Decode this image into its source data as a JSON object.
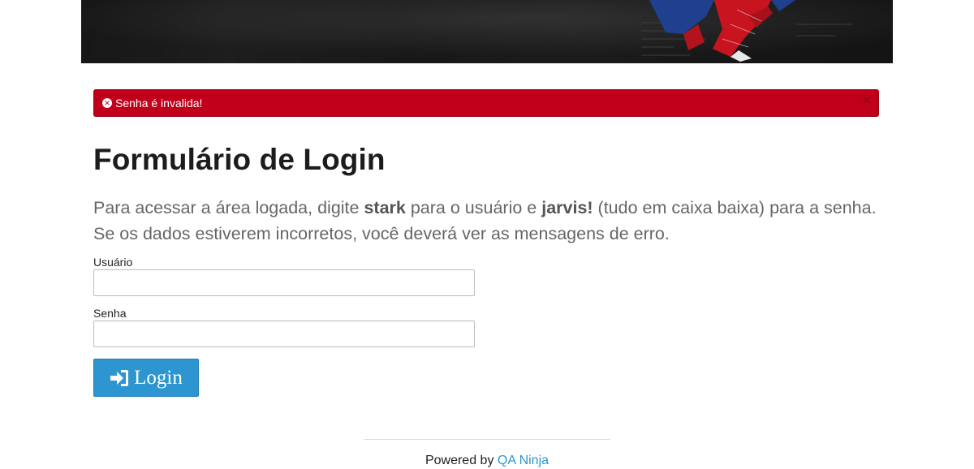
{
  "banner": {
    "image_icon": "spiderman-hero-image"
  },
  "alert": {
    "icon": "x-circle-icon",
    "message": "Senha é invalida!",
    "close_label": "×",
    "color": "#c0001a"
  },
  "page_title": "Formulário de Login",
  "instructions": {
    "line1_part1": "Para acessar a área logada, digite ",
    "user_value": "stark",
    "line1_part2": " para o usuário e ",
    "password_value": "jarvis!",
    "line1_part3": " (tudo em caixa baixa) para a senha.",
    "line2": "Se os dados estiverem incorretos, você deverá ver as mensagens de erro."
  },
  "form": {
    "username_label": "Usuário",
    "username_value": "",
    "password_label": "Senha",
    "password_value": "",
    "submit_label": "Login",
    "submit_icon": "sign-in-icon",
    "submit_color": "#2d95cf"
  },
  "footer": {
    "powered_text": "Powered by ",
    "link_text": "QA Ninja",
    "link_color": "#2d95cf"
  }
}
